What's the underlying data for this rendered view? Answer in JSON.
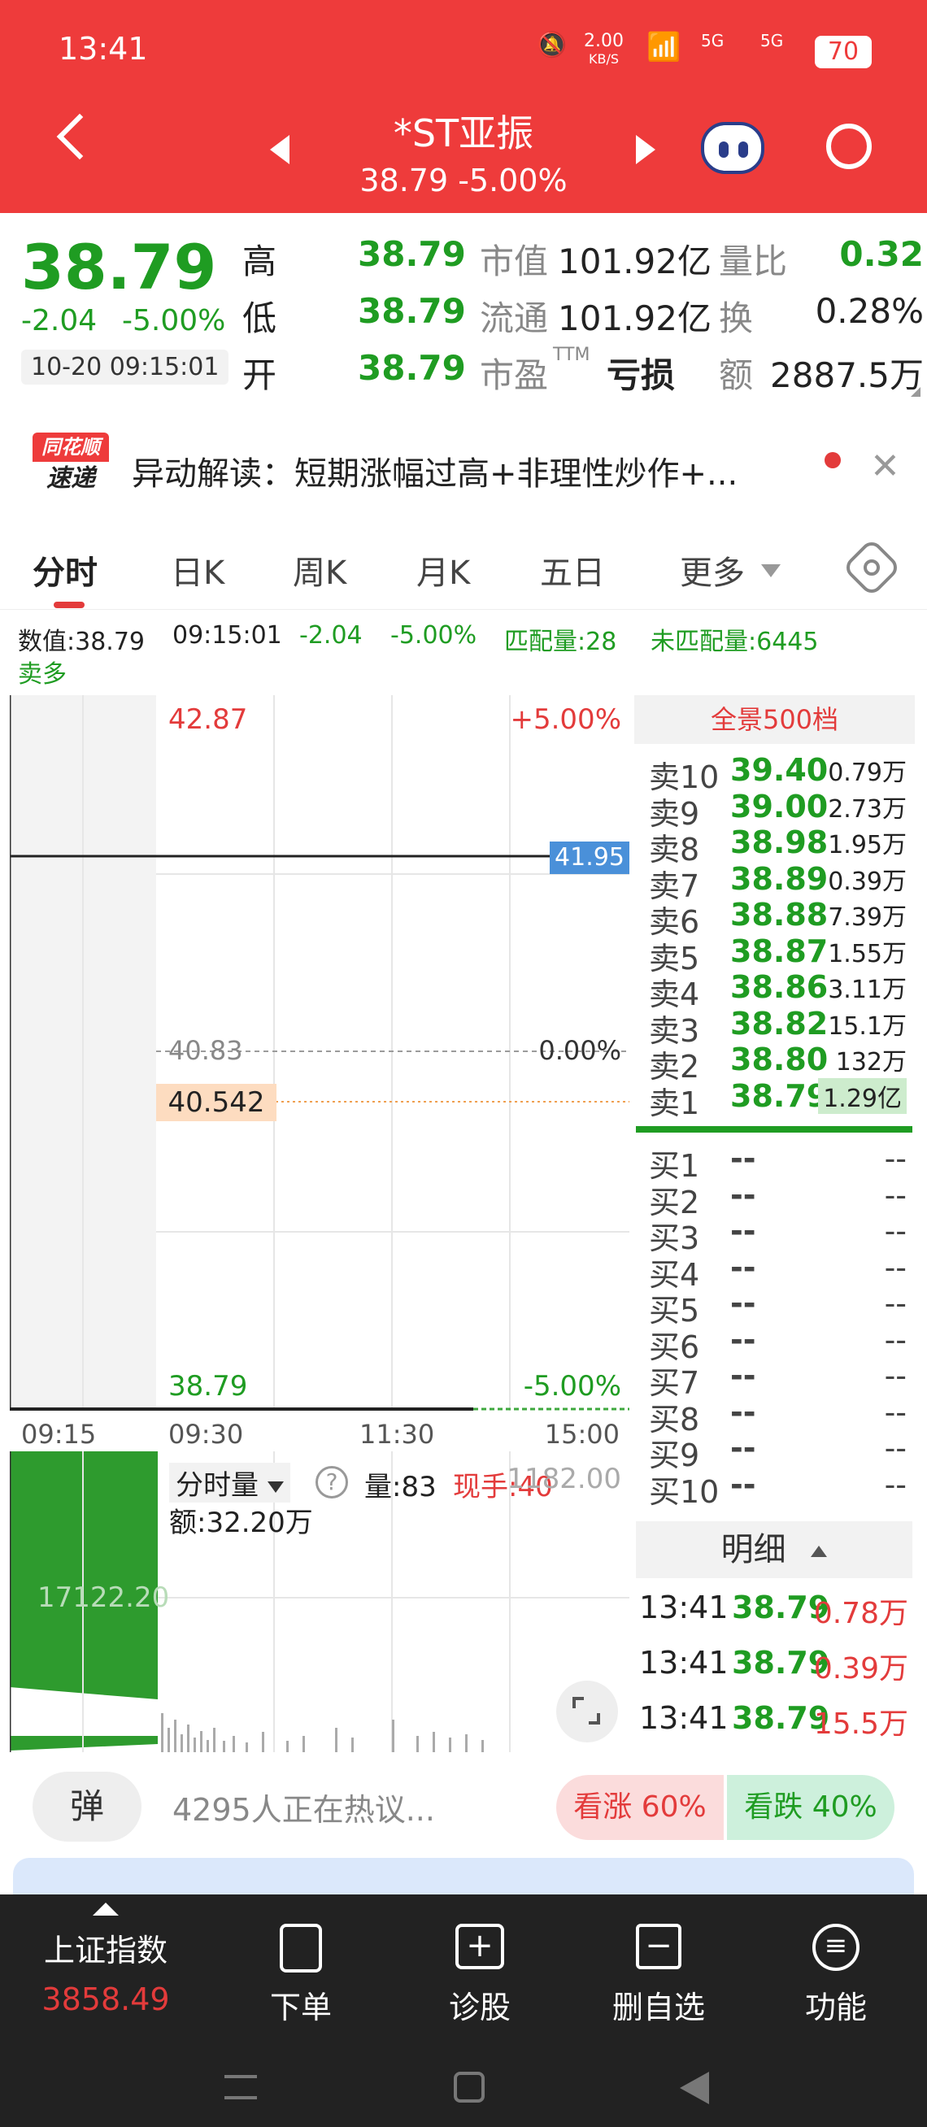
{
  "status": {
    "time": "13:41",
    "net_speed_top": "2.00",
    "net_speed_unit": "KB/S",
    "signal1": "5G",
    "signal2": "5G",
    "battery": "70"
  },
  "header": {
    "title": "*ST亚振",
    "subtitle": "38.79 -5.00%"
  },
  "quote": {
    "price": "38.79",
    "change": "-2.04",
    "change_pct": "-5.00%",
    "datetime": "10-20 09:15:01",
    "high_label": "高",
    "high": "38.79",
    "low_label": "低",
    "low": "38.79",
    "open_label": "开",
    "open": "38.79",
    "mcap_label": "市值",
    "mcap": "101.92亿",
    "float_label": "流通",
    "float": "101.92亿",
    "pe_label": "市盈",
    "pe_sup": "TTM",
    "pe": "亏损",
    "vr_label": "量比",
    "vr": "0.32",
    "turn_label": "换",
    "turn": "0.28%",
    "amt_label": "额",
    "amt": "2887.5万"
  },
  "banner": {
    "logo_top": "同花顺",
    "logo_bottom": "速递",
    "text": "异动解读：短期涨幅过高+非理性炒作+..."
  },
  "tabs": [
    "分时",
    "日K",
    "周K",
    "月K",
    "五日",
    "更多"
  ],
  "info": {
    "line1_value": "数值:38.79",
    "line1_time": "09:15:01",
    "line1_chg": "-2.04",
    "line1_pct": "-5.00%",
    "match": "匹配量:28",
    "unmatch": "未匹配量:6445",
    "line2": "卖多"
  },
  "chart": {
    "ymax": "42.87",
    "ymax_pct": "+5.00%",
    "ymid": "40.83",
    "ymid_pct": "0.00%",
    "ymin": "38.79",
    "ymin_pct": "-5.00%",
    "crosshair": "41.95",
    "avg": "40.542",
    "x": [
      "09:15",
      "09:30",
      "11:30",
      "15:00"
    ]
  },
  "volume": {
    "label": "分时量",
    "vol": "量:83",
    "hand": "现手:40",
    "amt": "额:32.20万",
    "max": "1182.00",
    "left": "17122.20"
  },
  "book": {
    "title": "全景500档",
    "sell": [
      [
        "卖10",
        "39.40",
        "0.79万"
      ],
      [
        "卖9",
        "39.00",
        "2.73万"
      ],
      [
        "卖8",
        "38.98",
        "1.95万"
      ],
      [
        "卖7",
        "38.89",
        "0.39万"
      ],
      [
        "卖6",
        "38.88",
        "7.39万"
      ],
      [
        "卖5",
        "38.87",
        "1.55万"
      ],
      [
        "卖4",
        "38.86",
        "3.11万"
      ],
      [
        "卖3",
        "38.82",
        "15.1万"
      ],
      [
        "卖2",
        "38.80",
        "132万"
      ],
      [
        "卖1",
        "38.79",
        "1.29亿"
      ]
    ],
    "buy": [
      [
        "买1",
        "--",
        "--"
      ],
      [
        "买2",
        "--",
        "--"
      ],
      [
        "买3",
        "--",
        "--"
      ],
      [
        "买4",
        "--",
        "--"
      ],
      [
        "买5",
        "--",
        "--"
      ],
      [
        "买6",
        "--",
        "--"
      ],
      [
        "买7",
        "--",
        "--"
      ],
      [
        "买8",
        "--",
        "--"
      ],
      [
        "买9",
        "--",
        "--"
      ],
      [
        "买10",
        "--",
        "--"
      ]
    ],
    "detail_title": "明细",
    "ticks": [
      [
        "13:41",
        "38.79",
        "0.78万"
      ],
      [
        "13:41",
        "38.79",
        "0.39万"
      ],
      [
        "13:41",
        "38.79",
        "15.5万"
      ]
    ]
  },
  "hot": {
    "btn": "弹",
    "text": "4295人正在热议...",
    "up": "看涨 60%",
    "down": "看跌 40%"
  },
  "nav": {
    "index_name": "上证指数",
    "index_val": "3858.49",
    "items": [
      "下单",
      "诊股",
      "删自选",
      "功能"
    ]
  }
}
